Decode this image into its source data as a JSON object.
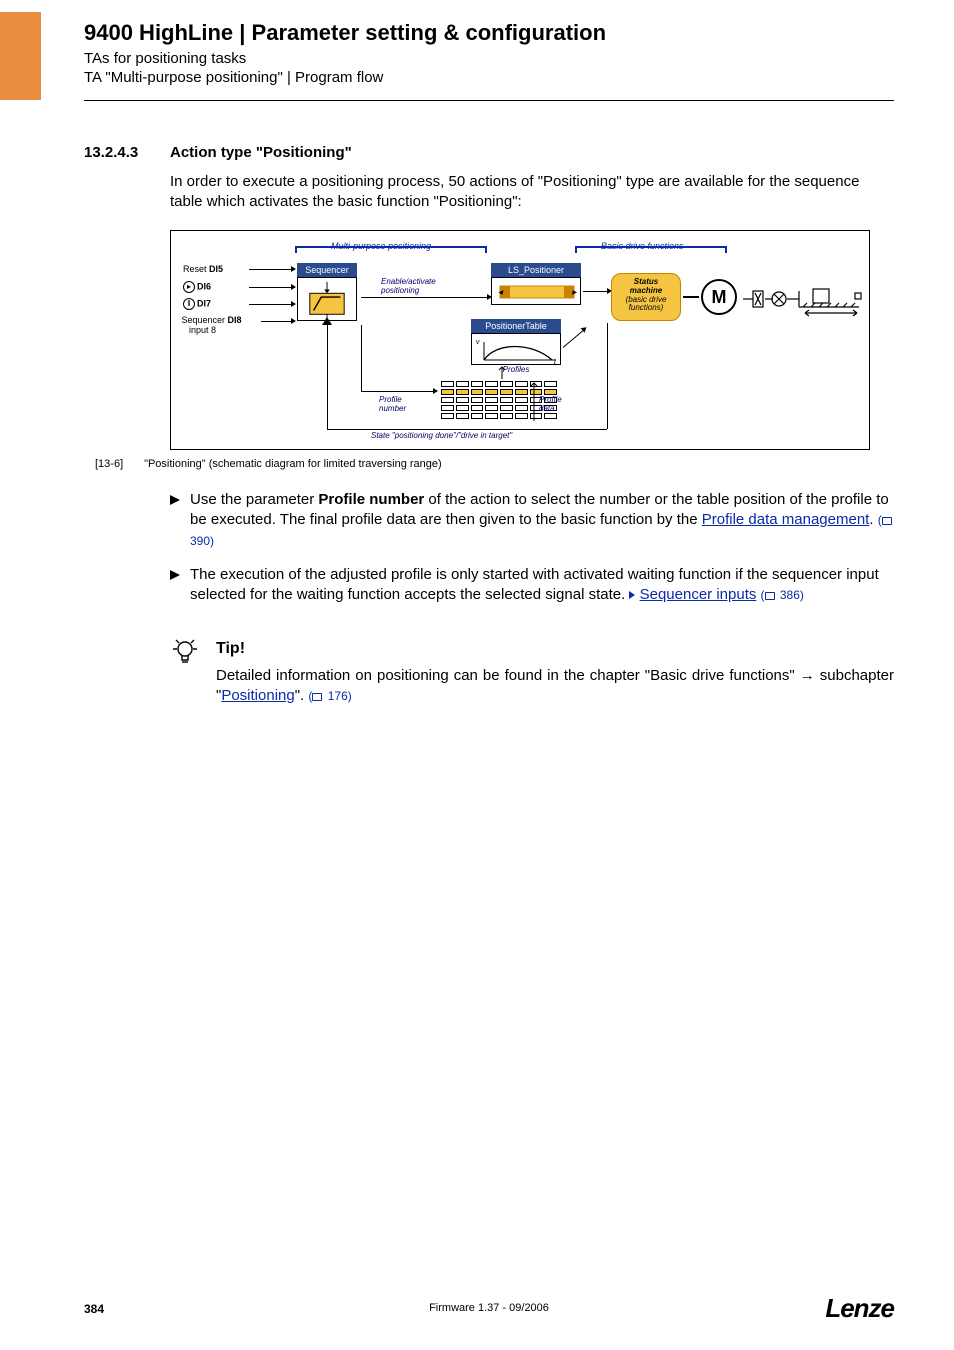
{
  "header": {
    "title": "9400 HighLine | Parameter setting & configuration",
    "sub1": "TAs for positioning tasks",
    "sub2": "TA \"Multi-purpose positioning\" | Program flow"
  },
  "section": {
    "number": "13.2.4.3",
    "title": "Action type \"Positioning\""
  },
  "intro": "In order to execute a positioning process, 50 actions of \"Positioning\" type are available for the sequence table which activates the basic function \"Positioning\":",
  "diagram": {
    "multi": "Multi-purpose positioning",
    "basic": "Basic drive functions",
    "reset": "Reset",
    "di5": "DI5",
    "di6": "DI6",
    "di7": "DI7",
    "di8": "DI8",
    "seq_in": "Sequencer",
    "seq_in2": "input 8",
    "sequencer": "Sequencer",
    "enable": "Enable/activate",
    "enable2": "positioning",
    "ls_pos": "LS_Positioner",
    "status1": "Status",
    "status2": "machine",
    "status3": "(basic drive",
    "status4": "functions)",
    "motor": "M",
    "ptable": "PositionerTable",
    "profiles": "Profiles",
    "profile_num1": "Profile",
    "profile_num2": "number",
    "profile_data1": "Profile",
    "profile_data2": "data",
    "state": "State \"positioning done\"/\"drive in target\""
  },
  "caption": {
    "num": "[13-6]",
    "text": "\"Positioning\" (schematic diagram for limited traversing range)"
  },
  "bullets": {
    "b1a": "Use the parameter ",
    "b1b": "Profile number",
    "b1c": " of the action to select the number or the table position of the profile to be executed. The final profile data are then given to the basic function by the ",
    "b1_link": "Profile data management",
    "b1_ref": "390)",
    "b2a": "The execution of the adjusted profile is only started with activated waiting function if the sequencer input selected for the waiting function accepts the selected signal state. ",
    "b2_link": "Sequencer inputs",
    "b2_ref": "386)"
  },
  "tip": {
    "label": "Tip!",
    "body1": "Detailed information on positioning can be found in the chapter \"Basic drive functions\" ",
    "body2": " subchapter \"",
    "link": "Positioning",
    "body3": "\". ",
    "ref": "176)"
  },
  "footer": {
    "page": "384",
    "fw": "Firmware 1.37 - 09/2006",
    "logo": "Lenze"
  }
}
